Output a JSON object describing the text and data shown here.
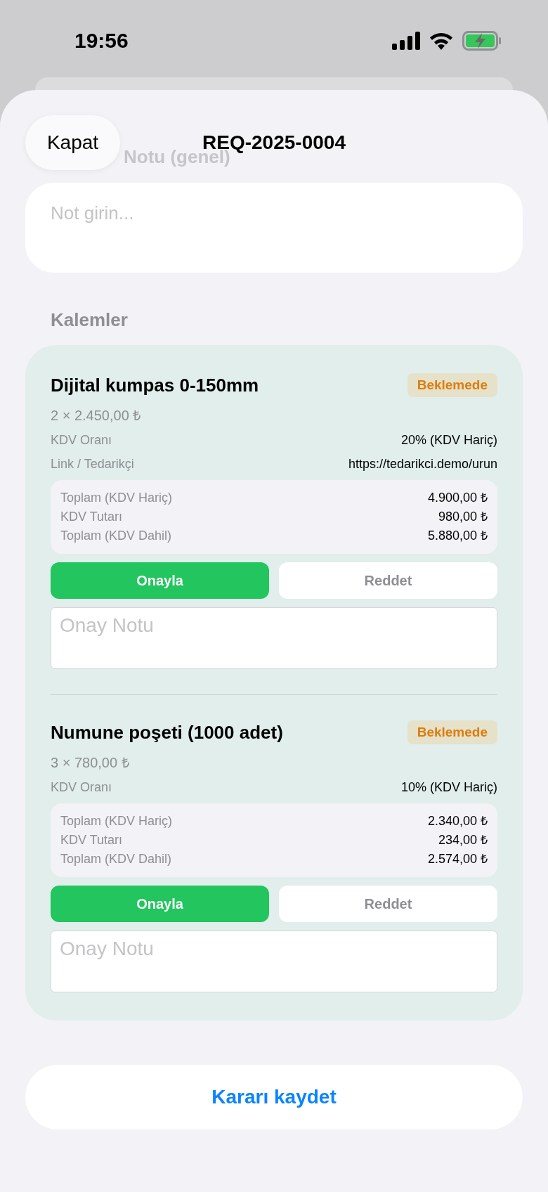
{
  "status_bar": {
    "time": "19:56"
  },
  "header": {
    "close_button": "Kapat",
    "title": "REQ-2025-0004",
    "background_label": "Notu (genel)"
  },
  "general_note": {
    "placeholder": "Not girin..."
  },
  "items_section": {
    "title": "Kalemler",
    "items": [
      {
        "name": "Dijital kumpas 0-150mm",
        "status": "Beklemede",
        "quantity": "2 × 2.450,00 ₺",
        "details": [
          {
            "label": "KDV Oranı",
            "value": "20% (KDV Hariç)"
          },
          {
            "label": "Link / Tedarikçi",
            "value": "https://tedarikci.demo/urun"
          }
        ],
        "totals": [
          {
            "label": "Toplam (KDV Hariç)",
            "value": "4.900,00 ₺"
          },
          {
            "label": "KDV Tutarı",
            "value": "980,00 ₺"
          },
          {
            "label": "Toplam (KDV Dahil)",
            "value": "5.880,00 ₺"
          }
        ],
        "actions": [
          {
            "kind": "approve",
            "label": "Onayla",
            "selected": true
          },
          {
            "kind": "reject",
            "label": "Reddet",
            "selected": false
          }
        ],
        "note": {
          "placeholder": "Onay Notu"
        }
      },
      {
        "name": "Numune poşeti (1000 adet)",
        "status": "Beklemede",
        "quantity": "3 × 780,00 ₺",
        "details": [
          {
            "label": "KDV Oranı",
            "value": "10% (KDV Hariç)"
          }
        ],
        "totals": [
          {
            "label": "Toplam (KDV Hariç)",
            "value": "2.340,00 ₺"
          },
          {
            "label": "KDV Tutarı",
            "value": "234,00 ₺"
          },
          {
            "label": "Toplam (KDV Dahil)",
            "value": "2.574,00 ₺"
          }
        ],
        "actions": [
          {
            "kind": "approve",
            "label": "Onayla",
            "selected": true
          },
          {
            "kind": "reject",
            "label": "Reddet",
            "selected": false
          }
        ],
        "note": {
          "placeholder": "Onay Notu"
        }
      }
    ]
  },
  "save_button": "Kararı kaydet"
}
